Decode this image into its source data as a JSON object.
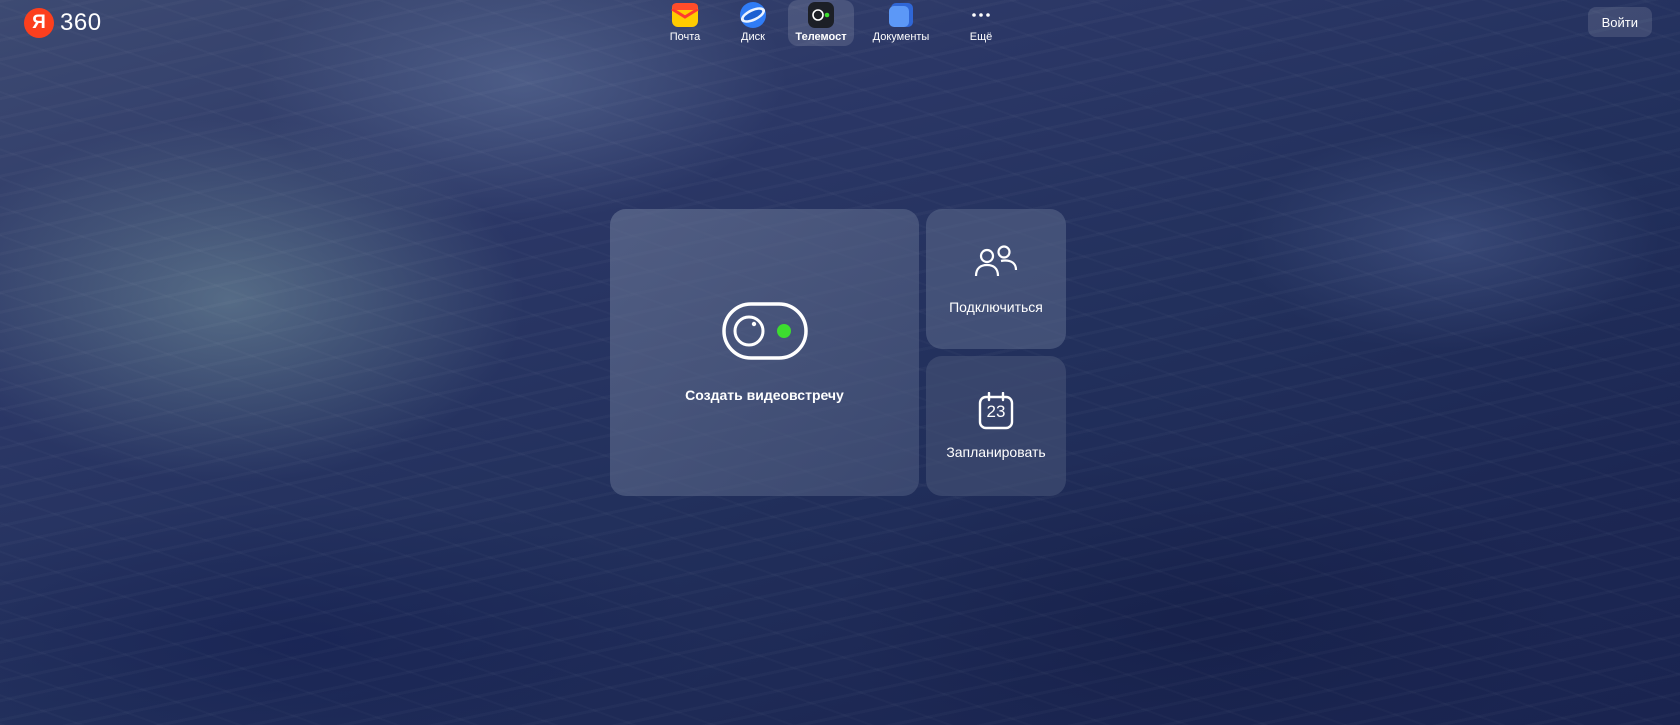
{
  "header": {
    "logo": {
      "letter": "Я",
      "text": "360"
    },
    "services": [
      {
        "id": "mail",
        "label": "Почта",
        "icon": "mail-icon"
      },
      {
        "id": "disk",
        "label": "Диск",
        "icon": "disk-icon"
      },
      {
        "id": "telemost",
        "label": "Телемост",
        "icon": "telemost-icon",
        "active": true
      },
      {
        "id": "docs",
        "label": "Документы",
        "icon": "documents-icon"
      },
      {
        "id": "more",
        "label": "Ещё",
        "icon": "more-dots-icon"
      }
    ],
    "login_label": "Войти"
  },
  "main": {
    "create_label": "Создать видеовстречу",
    "connect_label": "Подключиться",
    "schedule_label": "Запланировать",
    "calendar_day": "23"
  },
  "colors": {
    "brand_red": "#fc3f1d",
    "accent_green": "#3ddc2f",
    "mail_yellow": "#ffcc00",
    "disk_blue": "#2f7cf6",
    "docs_blue": "#4a8af4"
  }
}
